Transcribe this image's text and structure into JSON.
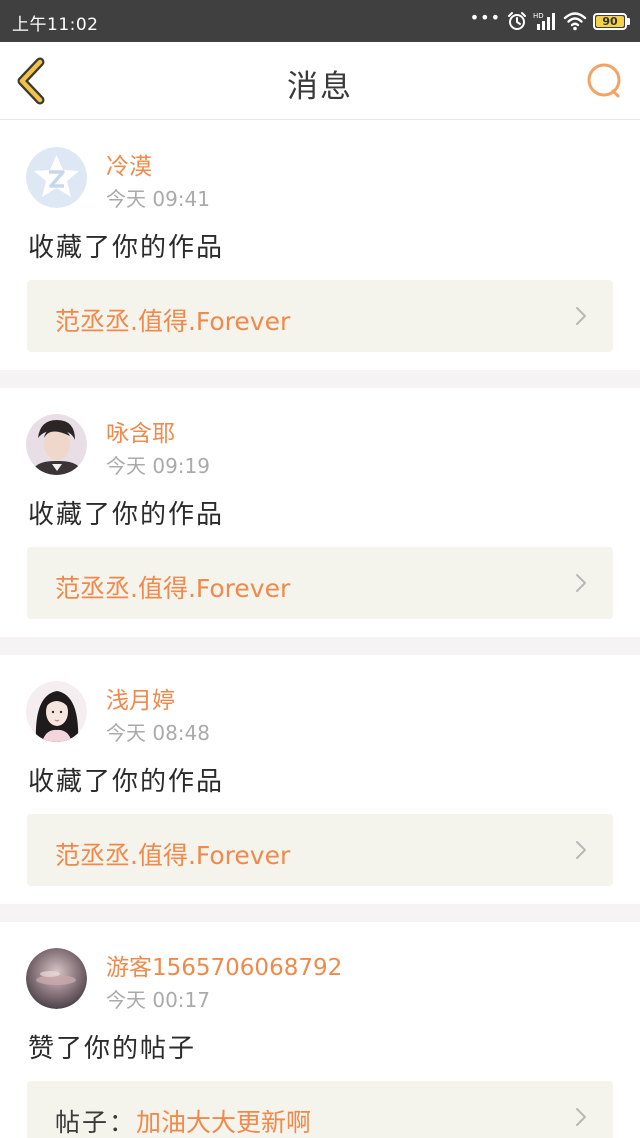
{
  "status_bar": {
    "time": "上午11:02",
    "battery_level": "90",
    "battery_color": "#f5d14a",
    "icons": [
      "more-dots-icon",
      "alarm-icon",
      "hd-signal-icon",
      "wifi-icon",
      "battery-icon"
    ]
  },
  "nav": {
    "title": "消息",
    "back_icon": "chevron-left-icon",
    "search_icon": "search-icon"
  },
  "theme": {
    "accent": "#ef8a4c",
    "nav_icon_color": "#f2c14e",
    "card_bg": "#f4f3ec"
  },
  "messages": [
    {
      "username": "冷漠",
      "time": "今天 09:41",
      "action": "收藏了你的作品",
      "work_prefix": "",
      "work_title": "范丞丞.值得.Forever"
    },
    {
      "username": "咏含耶",
      "time": "今天 09:19",
      "action": "收藏了你的作品",
      "work_prefix": "",
      "work_title": "范丞丞.值得.Forever"
    },
    {
      "username": "浅月婷",
      "time": "今天 08:48",
      "action": "收藏了你的作品",
      "work_prefix": "",
      "work_title": "范丞丞.值得.Forever"
    },
    {
      "username": "游客1565706068792",
      "time": "今天 00:17",
      "action": "赞了你的帖子",
      "work_prefix": "帖子：",
      "work_title": "加油大大更新啊"
    }
  ]
}
